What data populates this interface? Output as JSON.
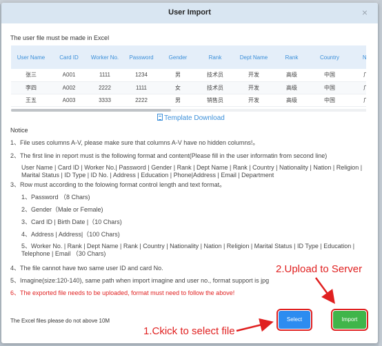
{
  "dialog": {
    "title": "User Import",
    "close_symbol": "×",
    "intro": "The user file must be made in Excel"
  },
  "table": {
    "columns": [
      "User Name",
      "Card ID",
      "Worker No.",
      "Password",
      "Gender",
      "Rank",
      "Dept Name",
      "Rank",
      "Country",
      "Na"
    ],
    "rows": [
      [
        "张三",
        "A001",
        "1111",
        "1234",
        "男",
        "技术员",
        "开发",
        "高级",
        "中国",
        "广"
      ],
      [
        "李四",
        "A002",
        "2222",
        "1111",
        "女",
        "技术员",
        "开发",
        "高级",
        "中国",
        "广"
      ],
      [
        "王五",
        "A003",
        "3333",
        "2222",
        "男",
        "销售员",
        "开发",
        "高级",
        "中国",
        "广"
      ]
    ]
  },
  "template_link": "Template Download",
  "notice": {
    "title": "Notice",
    "lines": [
      "1、File uses columns A-V, please make sure that columns A-V have no hidden columns!。",
      "2、The first line in report must is the following format and content(Please fill in the user informatin from second line)",
      "User Name | Card ID | Worker No.| Password | Gender | Rank | Dept Name | Rank | Country | Nationality | Nation | Religion | Marital Status | ID Type | ID No. | Address | Education | Phone|Address | Email | Department",
      "3、Row must according to the folowing format control length and text format。",
      "1、Password （8 Chars)",
      "2、Gender（Male or Female)",
      "3、Card ID | Birth Date |（10 Chars)",
      "4、Address | Address|（100 Chars)",
      "5、Worker No. | Rank | Dept Name | Rank | Country | Nationality | Nation | Religion | Marital Status | ID Type | Education | Telephone | Email （30 Chars)",
      "4、The file cannot have two same user ID and card No.",
      "5、Imagine(size:120-140), same path when import imagine and user no., format support is jpg",
      "6、The exported file needs to be uploaded, format must need to follow the above!"
    ]
  },
  "footer_note": "The Excel files please do not above 10M",
  "buttons": {
    "select": "Select",
    "import": "Import"
  },
  "annotations": {
    "step1": "1.Ckick to select file",
    "step2": "2.Upload to Server"
  },
  "colors": {
    "accent_blue": "#2d8cf0",
    "import_green": "#3fb54a",
    "annotation_red": "#e02020",
    "header_bg": "#d9e6f2"
  },
  "icons": {
    "close": "close-icon",
    "template": "document-icon"
  }
}
